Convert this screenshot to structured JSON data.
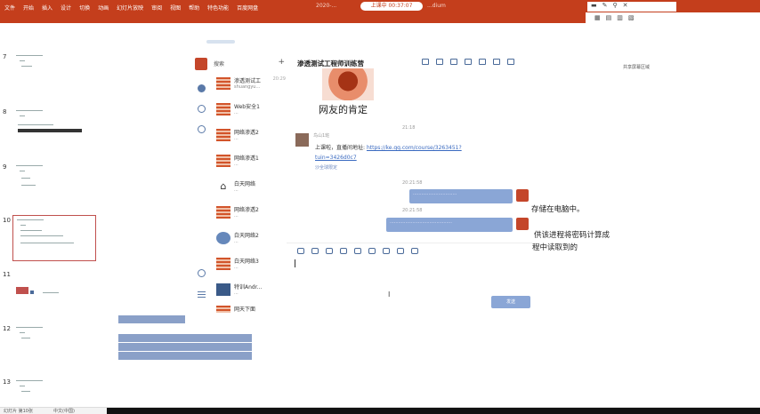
{
  "ribbon": {
    "tabs": [
      "文件",
      "开始",
      "插入",
      "设计",
      "切换",
      "动画",
      "幻灯片放映",
      "审阅",
      "视图",
      "帮助",
      "特色功能",
      "百度网盘"
    ],
    "doc_title": "2020-...",
    "doc_title2": "...dium",
    "recording": "上课中 00:37:07",
    "colors": {
      "ribbon": "#c43e1c",
      "accent": "#8aa6d6"
    }
  },
  "slides": {
    "numbers": [
      "7",
      "8",
      "9",
      "10",
      "11",
      "12",
      "13"
    ],
    "selected_index": 3
  },
  "qq": {
    "search_label": "搜索",
    "contacts": [
      {
        "name": "渗透测试工",
        "sub": "shuangyu...",
        "time": "20:29"
      },
      {
        "name": "Web安全1",
        "sub": "...",
        "time": ""
      },
      {
        "name": "网络渗透2",
        "sub": "...",
        "time": ""
      },
      {
        "name": "网络渗透1",
        "sub": "...",
        "time": ""
      },
      {
        "name": "白天网络",
        "sub": "...",
        "time": ""
      },
      {
        "name": "网络渗透2",
        "sub": "...",
        "time": ""
      },
      {
        "name": "白天网络2",
        "sub": "...",
        "time": ""
      },
      {
        "name": "白天网络3",
        "sub": "...",
        "time": ""
      },
      {
        "name": "特训Andr...",
        "sub": "...",
        "time": ""
      },
      {
        "name": "网天下面",
        "sub": "",
        "time": ""
      }
    ],
    "chat": {
      "title": "渗透测试工程师训练营",
      "meme_caption": "网友的肯定",
      "time1": "21:18",
      "sender_name": "鸟山1班",
      "msg1_prefix": "上课啦，直播间地址:",
      "msg1_link": "https://ke.qq.com/course/3263451?",
      "msg1_link2": "tuin=3426d0c7",
      "msg1_extra": "沙全球限定",
      "time2": "20:21:58",
      "bubble1": "...............................",
      "time3": "20:21:58",
      "bubble2": "............................................",
      "send_label": "发送"
    }
  },
  "slide_text": {
    "line1": "存储在电脑中。",
    "line2": "供该进程将密码计算成",
    "line3": "程中读取到的"
  },
  "right": {
    "upload": "共享屏幕区域"
  },
  "status": {
    "left": "幻灯片 第10张",
    "lang": "中文(中国)"
  }
}
